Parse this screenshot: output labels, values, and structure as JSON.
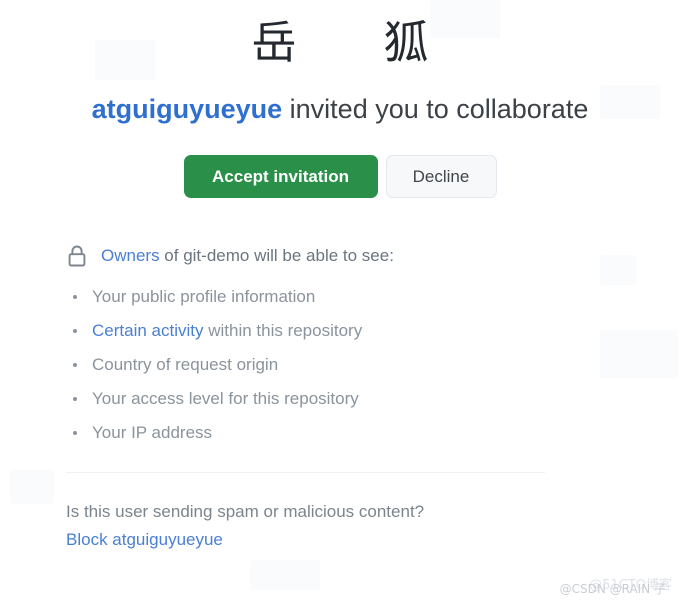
{
  "avatars": [
    {
      "name": "inviter-avatar",
      "glyph": "岳"
    },
    {
      "name": "invitee-avatar",
      "glyph": "狐"
    }
  ],
  "headline": {
    "username": "atguiguyueyue",
    "rest": " invited you to collaborate"
  },
  "actions": {
    "accept_label": "Accept invitation",
    "decline_label": "Decline"
  },
  "permissions": {
    "icon": "lock-icon",
    "owners_link": "Owners",
    "head_rest": " of git-demo will be able to see:",
    "repository": "git-demo",
    "items": [
      {
        "prefix": "Your public profile information",
        "link": "",
        "suffix": ""
      },
      {
        "prefix": "",
        "link": "Certain activity",
        "suffix": " within this repository"
      },
      {
        "prefix": "Country of request origin",
        "link": "",
        "suffix": ""
      },
      {
        "prefix": "Your access level for this repository",
        "link": "",
        "suffix": ""
      },
      {
        "prefix": "Your IP address",
        "link": "",
        "suffix": ""
      }
    ]
  },
  "footer": {
    "question": "Is this user sending spam or malicious content?",
    "block_link": "Block atguiguyueyue"
  },
  "watermark": {
    "back": "@51CTO博客",
    "front": "@CSDN @RAIN 子"
  },
  "colors": {
    "accent_green": "#2a9049",
    "link_blue": "#4a7fd4",
    "headline_blue": "#2f6fd0",
    "text_gray": "#6b7580",
    "muted_gray": "#8b939c",
    "divider": "#eef1f4",
    "decline_bg": "#f6f8fa"
  }
}
